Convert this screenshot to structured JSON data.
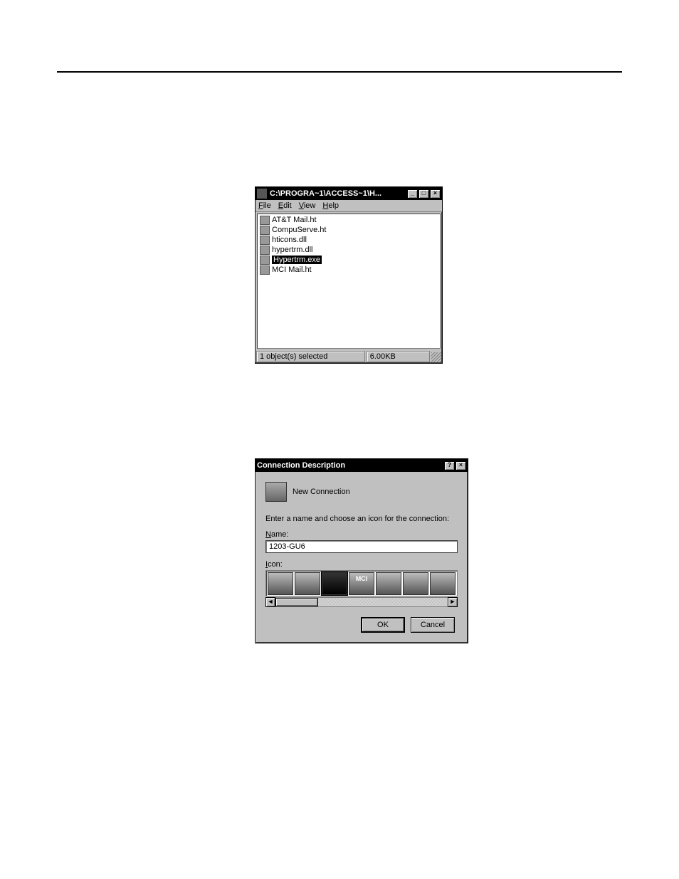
{
  "explorer": {
    "title": "C:\\PROGRA~1\\ACCESS~1\\H...",
    "menu": {
      "file": "File",
      "edit": "Edit",
      "view": "View",
      "help": "Help"
    },
    "files": [
      {
        "name": "AT&T Mail.ht"
      },
      {
        "name": "CompuServe.ht"
      },
      {
        "name": "hticons.dll"
      },
      {
        "name": "hypertrm.dll"
      },
      {
        "name": "Hypertrm.exe",
        "selected": true
      },
      {
        "name": "MCI Mail.ht"
      }
    ],
    "status": {
      "left": "1 object(s) selected",
      "mid": "6.00KB"
    },
    "buttons": {
      "min": "_",
      "max": "□",
      "close": "×"
    }
  },
  "dialog": {
    "title": "Connection Description",
    "subtitle": "New Connection",
    "prompt": "Enter a name and choose an icon for the connection:",
    "name_label": "Name:",
    "name_value": "1203-GU6",
    "icon_label": "Icon:",
    "buttons": {
      "ok": "OK",
      "cancel": "Cancel",
      "help": "?",
      "close": "×"
    },
    "scroll": {
      "left": "◄",
      "right": "►"
    }
  }
}
